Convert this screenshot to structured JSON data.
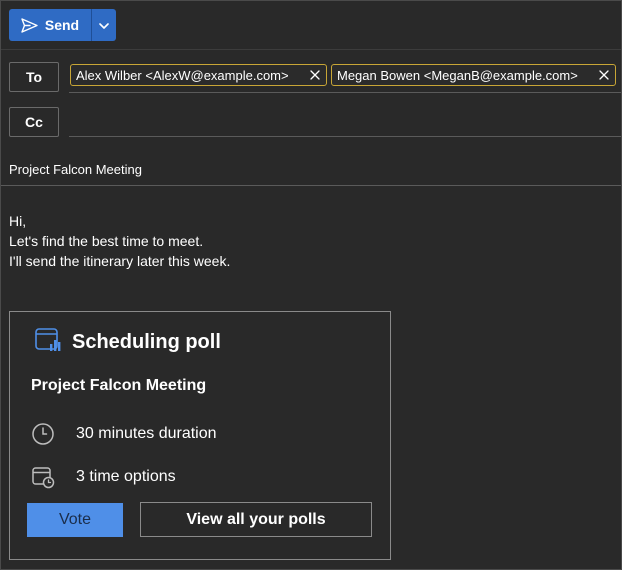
{
  "toolbar": {
    "send_label": "Send",
    "accent": "#2f6bc4"
  },
  "recipients": {
    "to_label": "To",
    "cc_label": "Cc",
    "to": [
      {
        "display": "Alex Wilber <AlexW@example.com>"
      },
      {
        "display": "Megan Bowen <MeganB@example.com>"
      }
    ],
    "chip_border_color": "#c8a636"
  },
  "subject": "Project Falcon Meeting",
  "body": {
    "lines": [
      "Hi,",
      "Let's find the best time to meet.",
      "I'll send the itinerary later this week."
    ]
  },
  "poll": {
    "title": "Scheduling poll",
    "meeting_name": "Project Falcon Meeting",
    "duration": "30 minutes duration",
    "options": "3 time options",
    "vote_label": "Vote",
    "view_all_label": "View all your polls",
    "vote_color": "#4f8fe8"
  },
  "icons": {
    "send": "send-icon",
    "dropdown": "chevron-down-icon",
    "remove": "close-icon",
    "poll": "poll-chart-icon",
    "clock": "clock-icon",
    "calendar": "calendar-clock-icon"
  }
}
